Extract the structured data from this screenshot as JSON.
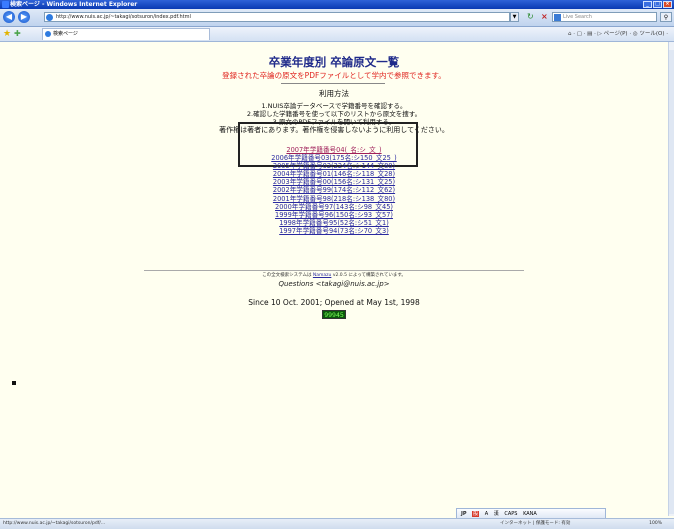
{
  "window": {
    "title": "検索ページ - Windows Internet Explorer"
  },
  "addressbar": {
    "url": "http://www.nuis.ac.jp/~takagi/sotsuron/index.pdf.html"
  },
  "searchbox": {
    "placeholder": "Live Search"
  },
  "tab": {
    "label": "検索ページ"
  },
  "tools": {
    "text": "⌂ · ▢ · ▤ · ▷ ページ(P) · ◎ ツール(O) ·"
  },
  "page": {
    "title": "卒業年度別 卒論原文一覧",
    "subtitle": "登録された卒論の原文をPDFファイルとして学内で参照できます。",
    "usage_heading": "利用方法",
    "steps": [
      "1.NUIS卒論データベースで学籍番号を確認する。",
      "2.確認した学籍番号を使って以下のリストから原文を捜す。",
      "3.原文のPDFファイルを開いて利用する。",
      "著作権は著者にあります。著作権を侵害しないように利用してください。"
    ],
    "year_links": [
      "2007年学籍番号04(_名:シ_文_)",
      "2006年学籍番号03(175名:シ150_文25_)",
      "2005年学籍番号02(224名:シ144_文80)",
      "2004年学籍番号01(146名:シ118_文28)",
      "2003年学籍番号00(156名:シ131_文25)",
      "2002年学籍番号99(174名:シ112_文62)",
      "2001年学籍番号98(218名:シ138_文80)",
      "2000年学籍番号97(143名:シ98_文45)",
      "1999年学籍番号96(150名:シ93_文57)",
      "1998年学籍番号95(52名:シ51_文1)",
      "1997年学籍番号94(73名:シ70_文3)"
    ],
    "credits_prefix": "この全文検索システムは",
    "credits_name": "Namazu",
    "credits_suffix": "v2.0.5 によって構築されています。",
    "questions": "Questions <takagi@nuis.ac.jp>",
    "since": "Since 10 Oct. 2001; Opened at May 1st, 1998",
    "counter": "99945"
  },
  "ime": {
    "jp": "JP",
    "mode": "般",
    "a": "A",
    "kanji": "漢",
    "caps": "CAPS",
    "kana": "KANA"
  },
  "status": {
    "url": "http://www.nuis.ac.jp/~takagi/sotsuron/pdf/...",
    "zone": "インターネット | 保護モード: 有効",
    "zoom": "100%"
  }
}
